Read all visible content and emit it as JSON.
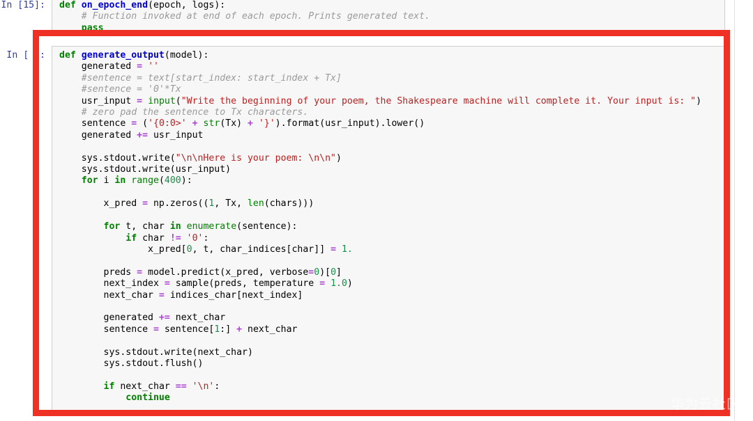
{
  "notebook": {
    "cells": [
      {
        "prompt": "In [15]:",
        "lines_html": "<span class=\"ln\"><span class=\"k\">def</span> <span class=\"nf\">on_epoch_end</span>(epoch, logs):</span><span class=\"ln\">    <span class=\"c\"># Function invoked at end of each epoch. Prints generated text.</span></span><span class=\"ln\">    <span class=\"k\">pass</span></span>"
      },
      {
        "prompt": "In [ ]:",
        "lines_html": "<span class=\"ln\"><span class=\"k\">def</span> <span class=\"nf\">generate_output</span>(model):</span><span class=\"ln\">    generated <span class=\"o\">=</span> <span class=\"s\">''</span></span><span class=\"ln\">    <span class=\"c\">#sentence = text[start_index: start_index + Tx]</span></span><span class=\"ln\">    <span class=\"c\">#sentence = '0'*Tx</span></span><span class=\"ln\">    usr_input <span class=\"o\">=</span> <span class=\"nb\">input</span>(<span class=\"s\">\"Write the beginning of your poem, the Shakespeare machine will complete it. Your input is: \"</span>)</span><span class=\"ln\">    <span class=\"c\"># zero pad the sentence to Tx characters.</span></span><span class=\"ln\">    sentence <span class=\"o\">=</span> (<span class=\"s\">'{0:0&gt;'</span> <span class=\"o\">+</span> <span class=\"nb\">str</span>(Tx) <span class=\"o\">+</span> <span class=\"s\">'}'</span>).format(usr_input).lower()</span><span class=\"ln\">    generated <span class=\"o\">+=</span> usr_input</span><span class=\"ln\"> </span><span class=\"ln\">    sys.stdout.write(<span class=\"s\">\"\\n\\nHere is your poem: \\n\\n\"</span>)</span><span class=\"ln\">    sys.stdout.write(usr_input)</span><span class=\"ln\">    <span class=\"k\">for</span> i <span class=\"k\">in</span> <span class=\"nb\">range</span>(<span class=\"mi\">400</span>):</span><span class=\"ln\"> </span><span class=\"ln\">        x_pred <span class=\"o\">=</span> np.zeros((<span class=\"mi\">1</span>, Tx, <span class=\"nb\">len</span>(chars)))</span><span class=\"ln\"> </span><span class=\"ln\">        <span class=\"k\">for</span> t, char <span class=\"k\">in</span> <span class=\"nb\">enumerate</span>(sentence):</span><span class=\"ln\">            <span class=\"k\">if</span> char <span class=\"o\">!=</span> <span class=\"s\">'0'</span>:</span><span class=\"ln\">                x_pred[<span class=\"mi\">0</span>, t, char_indices[char]] <span class=\"o\">=</span> <span class=\"mi\">1.</span></span><span class=\"ln\"> </span><span class=\"ln\">        preds <span class=\"o\">=</span> model.predict(x_pred, verbose<span class=\"o\">=</span><span class=\"mi\">0</span>)[<span class=\"mi\">0</span>]</span><span class=\"ln\">        next_index <span class=\"o\">=</span> sample(preds, temperature <span class=\"o\">=</span> <span class=\"mi\">1.0</span>)</span><span class=\"ln\">        next_char <span class=\"o\">=</span> indices_char[next_index]</span><span class=\"ln\"> </span><span class=\"ln\">        generated <span class=\"o\">+=</span> next_char</span><span class=\"ln\">        sentence <span class=\"o\">=</span> sentence[<span class=\"mi\">1</span>:] <span class=\"o\">+</span> next_char</span><span class=\"ln\"> </span><span class=\"ln\">        sys.stdout.write(next_char)</span><span class=\"ln\">        sys.stdout.flush()</span><span class=\"ln\"> </span><span class=\"ln\">        <span class=\"k\">if</span> next_char <span class=\"o\">==</span> <span class=\"s\">'\\n'</span>:</span><span class=\"ln\">            <span class=\"k\">continue</span></span>"
      }
    ]
  },
  "annotation": {
    "highlight_color": "#ee3124"
  },
  "watermark": {
    "text": "华为云社区"
  }
}
